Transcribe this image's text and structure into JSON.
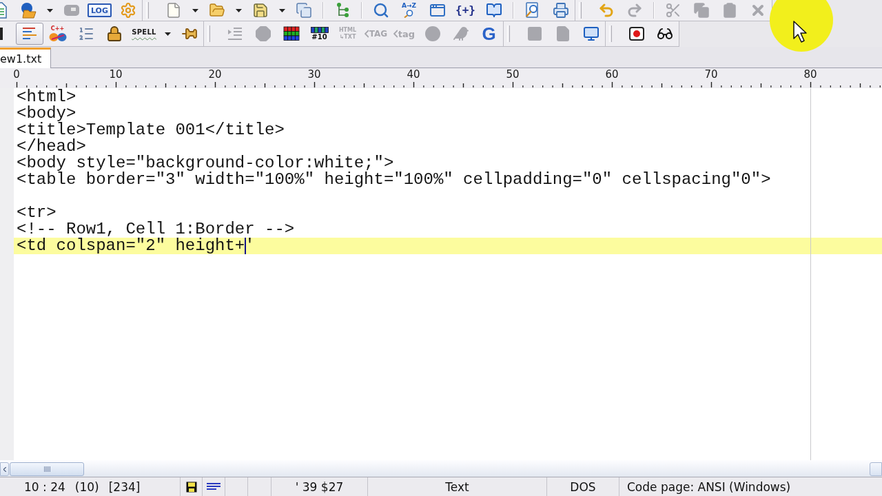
{
  "toolbar_rows": [
    [
      {
        "groups": [
          [
            {
              "kind": "document",
              "disabled": false,
              "pressed": false
            },
            {
              "kind": "project",
              "disabled": false,
              "pressed": false
            },
            {
              "kind": "caret",
              "disabled": false,
              "pressed": false
            },
            {
              "kind": "chip",
              "disabled": true,
              "pressed": false
            },
            {
              "kind": "log",
              "label": "LOG",
              "disabled": false,
              "pressed": false
            },
            {
              "kind": "gear",
              "disabled": false,
              "pressed": false
            }
          ]
        ]
      },
      {
        "groups": [
          [
            {
              "kind": "new-file",
              "disabled": false,
              "pressed": false
            },
            {
              "kind": "caret",
              "disabled": false,
              "pressed": false
            },
            {
              "kind": "open-folder",
              "disabled": false,
              "pressed": false
            },
            {
              "kind": "caret",
              "disabled": false,
              "pressed": false
            },
            {
              "kind": "save",
              "disabled": false,
              "pressed": false
            },
            {
              "kind": "caret",
              "disabled": false,
              "pressed": false
            },
            {
              "kind": "save-all",
              "disabled": false,
              "pressed": false
            }
          ],
          [
            {
              "kind": "tree",
              "disabled": false,
              "pressed": false
            }
          ],
          [
            {
              "kind": "search",
              "disabled": false,
              "pressed": false
            },
            {
              "kind": "sort-search",
              "label": "A→Z",
              "disabled": false,
              "pressed": false
            },
            {
              "kind": "find-window",
              "disabled": false,
              "pressed": false
            },
            {
              "kind": "braces",
              "label": "{+}",
              "disabled": false,
              "pressed": false
            },
            {
              "kind": "book",
              "disabled": false,
              "pressed": false
            }
          ],
          [
            {
              "kind": "preview",
              "disabled": false,
              "pressed": false
            },
            {
              "kind": "print",
              "disabled": false,
              "pressed": false
            }
          ]
        ]
      },
      {
        "groups": [
          [
            {
              "kind": "undo",
              "disabled": false,
              "pressed": false
            },
            {
              "kind": "redo",
              "disabled": true,
              "pressed": false
            }
          ],
          [
            {
              "kind": "cut",
              "disabled": true,
              "pressed": false
            },
            {
              "kind": "copy",
              "disabled": true,
              "pressed": false
            },
            {
              "kind": "paste",
              "disabled": true,
              "pressed": false
            },
            {
              "kind": "delete",
              "disabled": true,
              "pressed": false
            }
          ]
        ]
      }
    ],
    [
      {
        "groups": [
          [
            {
              "kind": "edge",
              "disabled": false,
              "pressed": false
            },
            {
              "kind": "word-wrap",
              "disabled": false,
              "pressed": true
            },
            {
              "kind": "syntax",
              "label": "C++",
              "disabled": false,
              "pressed": false
            },
            {
              "kind": "line-numbers",
              "disabled": false,
              "pressed": false
            },
            {
              "kind": "lock",
              "disabled": false,
              "pressed": false
            },
            {
              "kind": "spell",
              "label": "SPELL",
              "disabled": false,
              "pressed": false
            },
            {
              "kind": "caret",
              "disabled": false,
              "pressed": false
            },
            {
              "kind": "pin",
              "disabled": false,
              "pressed": false
            }
          ]
        ]
      },
      {
        "groups": [
          [
            {
              "kind": "indent",
              "disabled": true,
              "pressed": false
            },
            {
              "kind": "octagon",
              "disabled": true,
              "pressed": false
            },
            {
              "kind": "color-grid",
              "disabled": false,
              "pressed": false
            },
            {
              "kind": "grid-10",
              "label": "#10",
              "disabled": false,
              "pressed": false
            },
            {
              "kind": "html-txt",
              "label": "HTML ↳TXT",
              "disabled": true,
              "pressed": false
            },
            {
              "kind": "tag",
              "label": "TAG",
              "disabled": true,
              "pressed": false
            },
            {
              "kind": "tag-lower",
              "label": "tag",
              "disabled": true,
              "pressed": false
            },
            {
              "kind": "circle",
              "disabled": true,
              "pressed": false
            },
            {
              "kind": "bird",
              "disabled": true,
              "pressed": false
            },
            {
              "kind": "google",
              "label": "G",
              "disabled": false,
              "pressed": false
            }
          ]
        ]
      },
      {
        "groups": [
          [
            {
              "kind": "square",
              "disabled": true,
              "pressed": false
            },
            {
              "kind": "page",
              "disabled": true,
              "pressed": false
            },
            {
              "kind": "monitor",
              "disabled": false,
              "pressed": false
            }
          ]
        ]
      },
      {
        "groups": [
          [
            {
              "kind": "record",
              "disabled": false,
              "pressed": false
            },
            {
              "kind": "glasses",
              "disabled": false,
              "pressed": false
            }
          ]
        ]
      }
    ]
  ],
  "tabs": [
    {
      "label": "ew1.txt",
      "selected": true
    }
  ],
  "ruler": {
    "labels": [
      "0",
      "10",
      "20",
      "30",
      "40",
      "50",
      "60",
      "70",
      "80"
    ]
  },
  "editor": {
    "lines": [
      {
        "text": "<html>",
        "current": false
      },
      {
        "text": "<body>",
        "current": false
      },
      {
        "text": "<title>Template 001</title>",
        "current": false
      },
      {
        "text": "</head>",
        "current": false
      },
      {
        "text": "<body style=\"background-color:white;\">",
        "current": false
      },
      {
        "text": "<table border=\"3\" width=\"100%\" height=\"100%\" cellpadding=\"0\" cellspacing\"0\">",
        "current": false
      },
      {
        "current": false
      },
      {
        "text": "<tr>",
        "current": false
      },
      {
        "text": "<!-- Row1, Cell 1:Border -->",
        "current": false
      },
      {
        "text": "<td colspan=\"2\" height+",
        "after_caret": "'",
        "current": true
      }
    ]
  },
  "status_bar": {
    "position": "10 : 24",
    "field_2": "(10)",
    "field_3": "[234]",
    "character": "' 39 $27",
    "mode": "Text",
    "line_breaks": "DOS",
    "code_page": "Code page: ANSI (Windows)"
  }
}
